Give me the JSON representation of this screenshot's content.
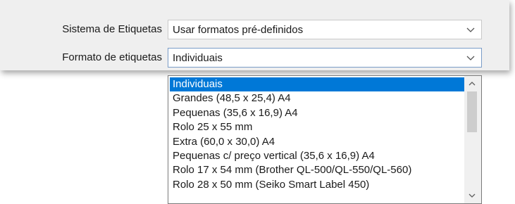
{
  "form": {
    "system_label": "Sistema de Etiquetas",
    "system_value": "Usar formatos pré-definidos",
    "format_label": "Formato de etiquetas",
    "format_value": "Individuais"
  },
  "dropdown": {
    "selected_index": 0,
    "options": [
      "Individuais",
      "Grandes (48,5 x 25,4) A4",
      "Pequenas (35,6 x 16,9) A4",
      "Rolo 25 x 55 mm",
      "Extra (60,0 x 30,0) A4",
      "Pequenas c/ preço vertical (35,6 x 16,9) A4",
      "Rolo 17 x 54 mm (Brother QL-500/QL-550/QL-560)",
      "Rolo 28 x 50 mm (Seiko Smart Label 450)"
    ]
  },
  "icons": {
    "combo_arrow": "chevron-down-icon",
    "scroll_up": "scroll-up-arrow-icon",
    "scroll_down": "scroll-down-arrow-icon"
  },
  "colors": {
    "selection": "#0078d7",
    "panel": "#efefef"
  }
}
